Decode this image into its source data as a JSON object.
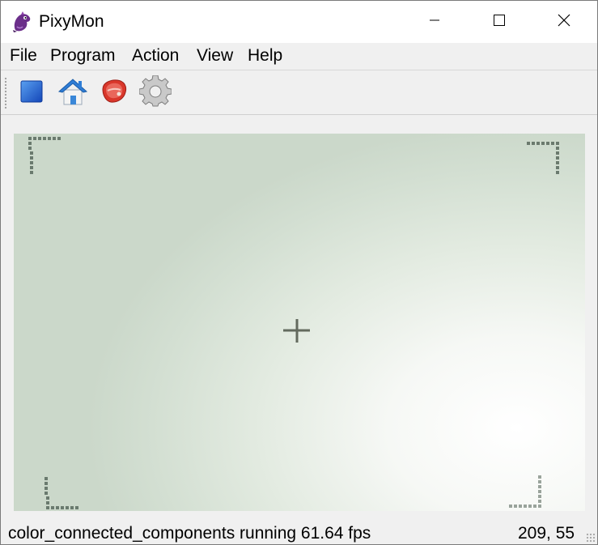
{
  "window": {
    "title": "PixyMon",
    "icon": "pixymon-logo-icon",
    "controls": [
      "minimize-icon",
      "maximize-icon",
      "close-icon"
    ]
  },
  "menubar": {
    "file": "File",
    "program": "Program",
    "action": "Action",
    "view": "View",
    "help": "Help"
  },
  "toolbar": {
    "items": [
      "stop-icon",
      "home-icon",
      "raw-video-icon",
      "gear-icon"
    ]
  },
  "statusbar": {
    "text": "color_connected_components running 61.64 fps",
    "coords": "209, 55"
  }
}
